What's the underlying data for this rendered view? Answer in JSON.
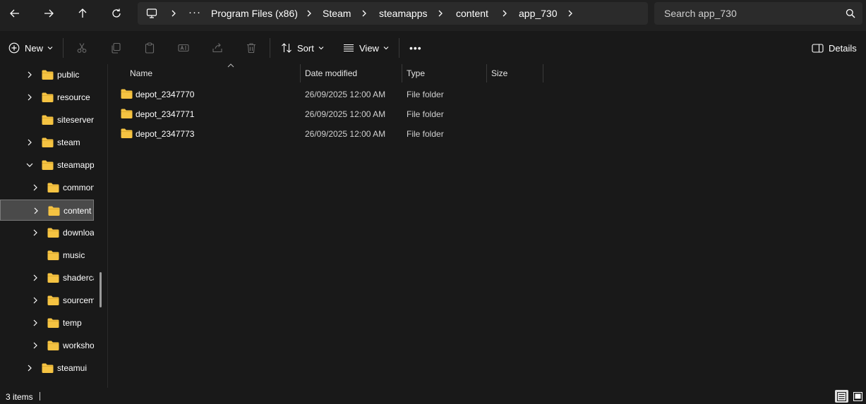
{
  "nav_buttons": [
    "back",
    "forward",
    "up",
    "refresh"
  ],
  "breadcrumb": {
    "overflow": "···",
    "items": [
      "Program Files (x86)",
      "Steam",
      "steamapps",
      "content",
      "app_730"
    ]
  },
  "search": {
    "placeholder": "Search app_730"
  },
  "toolbar": {
    "new_label": "New",
    "sort_label": "Sort",
    "view_label": "View",
    "more_label": "•••",
    "details_label": "Details"
  },
  "tree": [
    {
      "label": "public",
      "indent": 0,
      "expander": "collapsed"
    },
    {
      "label": "resource",
      "indent": 0,
      "expander": "collapsed"
    },
    {
      "label": "siteserverui",
      "indent": 0,
      "expander": "none"
    },
    {
      "label": "steam",
      "indent": 0,
      "expander": "collapsed"
    },
    {
      "label": "steamapps",
      "indent": 0,
      "expander": "expanded"
    },
    {
      "label": "common",
      "indent": 1,
      "expander": "collapsed"
    },
    {
      "label": "content",
      "indent": 1,
      "expander": "collapsed",
      "selected": true
    },
    {
      "label": "downloading",
      "indent": 1,
      "expander": "collapsed"
    },
    {
      "label": "music",
      "indent": 1,
      "expander": "none"
    },
    {
      "label": "shadercache",
      "indent": 1,
      "expander": "collapsed"
    },
    {
      "label": "sourcemods",
      "indent": 1,
      "expander": "collapsed"
    },
    {
      "label": "temp",
      "indent": 1,
      "expander": "collapsed"
    },
    {
      "label": "workshop",
      "indent": 1,
      "expander": "collapsed"
    },
    {
      "label": "steamui",
      "indent": 0,
      "expander": "collapsed"
    }
  ],
  "columns": {
    "name": "Name",
    "date": "Date modified",
    "type": "Type",
    "size": "Size"
  },
  "files": [
    {
      "name": "depot_2347770",
      "date": "26/09/2025 12:00 AM",
      "type": "File folder",
      "size": ""
    },
    {
      "name": "depot_2347771",
      "date": "26/09/2025 12:00 AM",
      "type": "File folder",
      "size": ""
    },
    {
      "name": "depot_2347773",
      "date": "26/09/2025 12:00 AM",
      "type": "File folder",
      "size": ""
    }
  ],
  "status": {
    "item_count": "3 items"
  },
  "colors": {
    "folder": "#f5c342",
    "background": "#191919",
    "bar": "#2b2b2b"
  }
}
